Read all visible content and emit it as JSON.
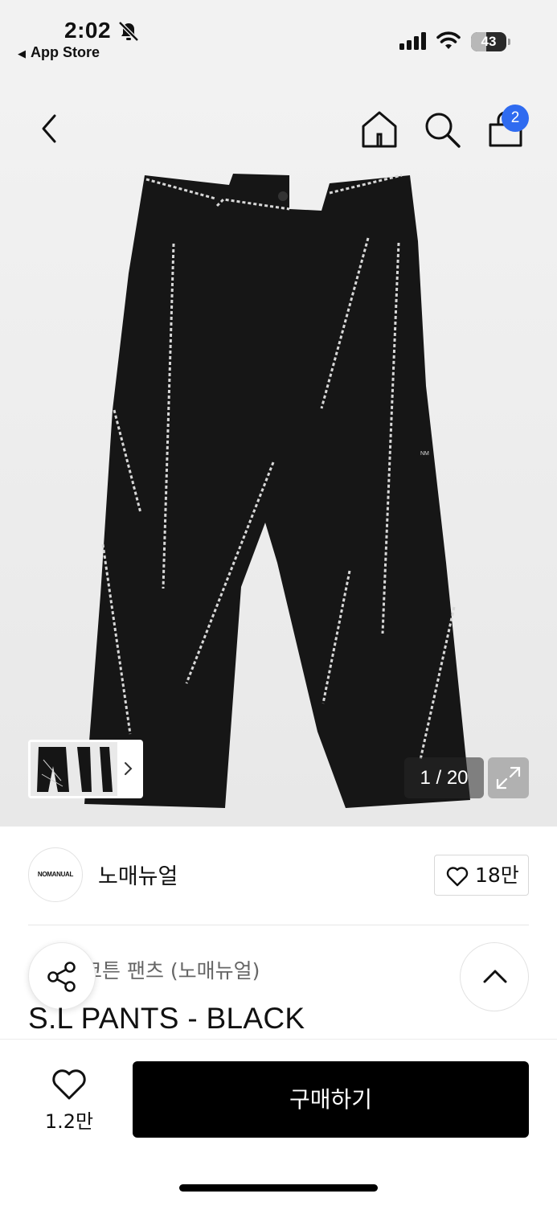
{
  "status_bar": {
    "time": "2:02",
    "back_app": "App Store",
    "battery": "43",
    "battery_level": 0.43
  },
  "nav": {
    "cart_badge": "2"
  },
  "gallery": {
    "page_counter": "1 / 20"
  },
  "brand": {
    "logo_text": "NOMANUAL",
    "name": "노매뉴얼",
    "like_count": "18만"
  },
  "product": {
    "category": "코튼 팬츠 (노매뉴얼)",
    "name": "S.L PANTS - BLACK"
  },
  "bottom_bar": {
    "wish_count": "1.2만",
    "buy_label": "구매하기"
  },
  "icons": [
    "bell-slash-icon",
    "signal-icon",
    "wifi-icon",
    "battery-icon",
    "back-icon",
    "home-icon",
    "search-icon",
    "cart-icon",
    "chevron-right-icon",
    "expand-icon",
    "heart-icon",
    "share-icon",
    "chevron-up-icon"
  ]
}
